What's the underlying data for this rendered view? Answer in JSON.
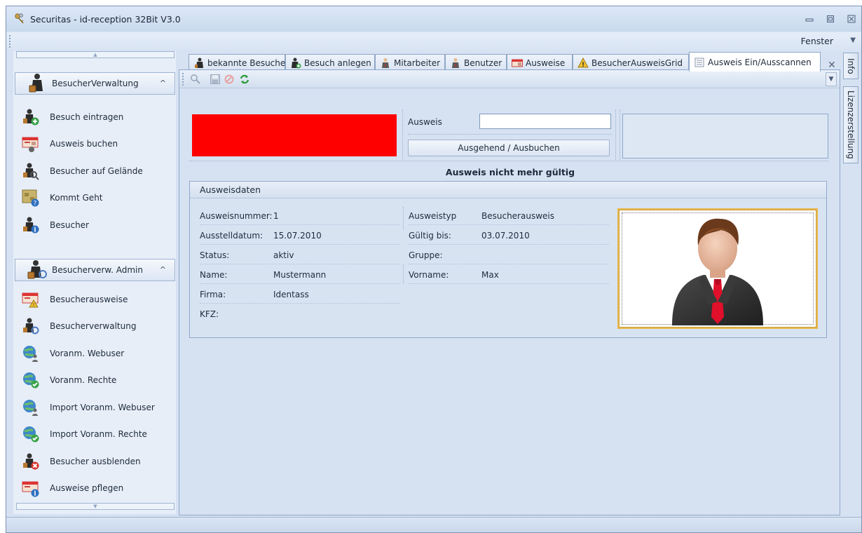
{
  "window": {
    "title": "Securitas - id-reception 32Bit V3.0"
  },
  "menubar": {
    "fenster": "Fenster"
  },
  "sidebar": {
    "groups": [
      {
        "label": "BesucherVerwaltung",
        "items": [
          {
            "label": "Besuch eintragen",
            "icon": "visitor-add-icon"
          },
          {
            "label": "Ausweis buchen",
            "icon": "badge-book-icon"
          },
          {
            "label": "Besucher auf Gelände",
            "icon": "visitor-search-icon"
          },
          {
            "label": "Kommt Geht",
            "icon": "map-help-icon"
          },
          {
            "label": "Besucher",
            "icon": "visitor-info-icon"
          }
        ]
      },
      {
        "label": "Besucherverw. Admin",
        "items": [
          {
            "label": "Besucherausweise",
            "icon": "badge-warning-icon"
          },
          {
            "label": "Besucherverwaltung",
            "icon": "visitor-admin-icon"
          },
          {
            "label": "Voranm. Webuser",
            "icon": "globe-user-icon"
          },
          {
            "label": "Voranm. Rechte",
            "icon": "globe-check-icon"
          },
          {
            "label": "Import Voranm. Webuser",
            "icon": "globe-user-icon"
          },
          {
            "label": "Import Voranm. Rechte",
            "icon": "globe-check-icon"
          },
          {
            "label": "Besucher ausblenden",
            "icon": "visitor-remove-icon"
          },
          {
            "label": "Ausweise pflegen",
            "icon": "badge-info-icon"
          }
        ]
      }
    ]
  },
  "tabs": [
    {
      "label": "bekannte Besucher"
    },
    {
      "label": "Besuch anlegen"
    },
    {
      "label": "Mitarbeiter"
    },
    {
      "label": "Benutzer"
    },
    {
      "label": "Ausweise"
    },
    {
      "label": "BesucherAusweisGrid"
    },
    {
      "label": "Ausweis Ein/Ausscannen",
      "active": true
    }
  ],
  "side_tabs": {
    "info": "Info",
    "lizenz": "Lizenzerstellung"
  },
  "scan": {
    "ausweis_label": "Ausweis",
    "ausweis_value": "",
    "button_label": "Ausgehend / Ausbuchen",
    "status_color": "#ff0000",
    "message": "Ausweis nicht mehr gültig"
  },
  "ausweisdaten": {
    "title": "Ausweisdaten",
    "left": [
      {
        "label": "Ausweisnummer:",
        "value": "1"
      },
      {
        "label": "Ausstelldatum:",
        "value": "15.07.2010"
      },
      {
        "label": "Status:",
        "value": "aktiv"
      },
      {
        "label": "Name:",
        "value": "Mustermann"
      },
      {
        "label": "Firma:",
        "value": "Identass"
      },
      {
        "label": "KFZ:",
        "value": ""
      }
    ],
    "right": [
      {
        "label": "Ausweistyp",
        "value": "Besucherausweis"
      },
      {
        "label": "Gültig bis:",
        "value": "03.07.2010"
      },
      {
        "label": "Gruppe:",
        "value": ""
      },
      {
        "label": "Vorname:",
        "value": "Max"
      }
    ]
  },
  "colors": {
    "accent": "#e9b84c",
    "status": "#ff0000",
    "background": "#d6e2f2"
  }
}
